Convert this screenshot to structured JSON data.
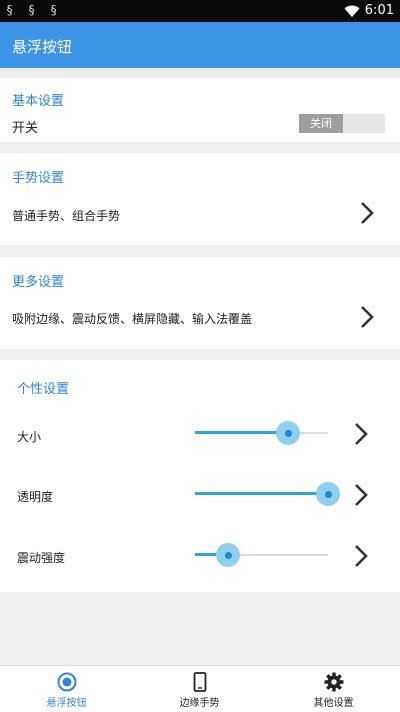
{
  "status_bar": {
    "notification_icons": [
      "notification-icon",
      "notification-icon",
      "notification-icon"
    ],
    "time": "6:01"
  },
  "app_bar": {
    "title": "悬浮按钮"
  },
  "basic": {
    "title": "基本设置",
    "switch_label": "开关",
    "switch_state_text": "关闭"
  },
  "gesture": {
    "title": "手势设置",
    "row_label": "普通手势、组合手势"
  },
  "more": {
    "title": "更多设置",
    "row_label": "吸附边缘、震动反馈、横屏隐藏、输入法覆盖"
  },
  "personal": {
    "title": "个性设置",
    "sliders": [
      {
        "label": "大小",
        "value": 0.7
      },
      {
        "label": "透明度",
        "value": 1.0
      },
      {
        "label": "震动强度",
        "value": 0.25
      }
    ]
  },
  "bottom_nav": {
    "active_color": "#2e86d6",
    "items": [
      {
        "label": "悬浮按钮",
        "icon": "floating-button-icon",
        "active": true
      },
      {
        "label": "边缘手势",
        "icon": "phone-icon",
        "active": false
      },
      {
        "label": "其他设置",
        "icon": "gear-icon",
        "active": false
      }
    ]
  },
  "colors": {
    "app_bar": "#3d93e6",
    "section_title": "#2e86d6",
    "slider_fill": "#2ea3dc"
  }
}
